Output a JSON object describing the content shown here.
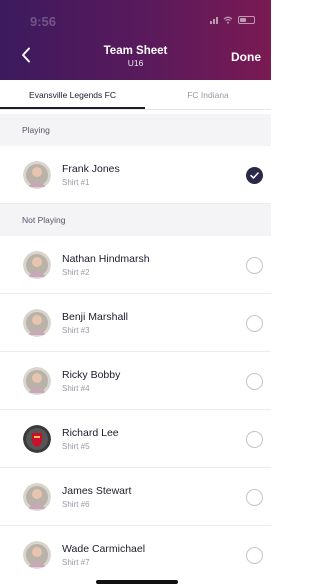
{
  "status_bar": {
    "time": "9:56"
  },
  "nav": {
    "back_icon": "chevron-left-icon",
    "title": "Team Sheet",
    "subtitle": "U16",
    "done_label": "Done"
  },
  "tabs": [
    {
      "label": "Evansville Legends FC",
      "active": true
    },
    {
      "label": "FC Indiana",
      "active": false
    }
  ],
  "sections": {
    "playing": {
      "title": "Playing",
      "players": [
        {
          "name": "Frank Jones",
          "shirt": "Shirt #1",
          "selected": true,
          "avatar": "player-photo-avatar"
        }
      ]
    },
    "not_playing": {
      "title": "Not Playing",
      "players": [
        {
          "name": "Nathan Hindmarsh",
          "shirt": "Shirt #2",
          "selected": false,
          "avatar": "player-photo-avatar"
        },
        {
          "name": "Benji Marshall",
          "shirt": "Shirt #3",
          "selected": false,
          "avatar": "player-photo-avatar"
        },
        {
          "name": "Ricky Bobby",
          "shirt": "Shirt #4",
          "selected": false,
          "avatar": "player-photo-avatar"
        },
        {
          "name": "Richard Lee",
          "shirt": "Shirt #5",
          "selected": false,
          "avatar": "club-crest-avatar"
        },
        {
          "name": "James Stewart",
          "shirt": "Shirt #6",
          "selected": false,
          "avatar": "player-photo-avatar"
        },
        {
          "name": "Wade Carmichael",
          "shirt": "Shirt #7",
          "selected": false,
          "avatar": "player-photo-avatar"
        }
      ]
    }
  },
  "colors": {
    "header_gradient_start": "#3c1a5e",
    "header_gradient_end": "#7a1a52",
    "checked": "#2a2a48",
    "section_bg": "#f4f4f7"
  }
}
